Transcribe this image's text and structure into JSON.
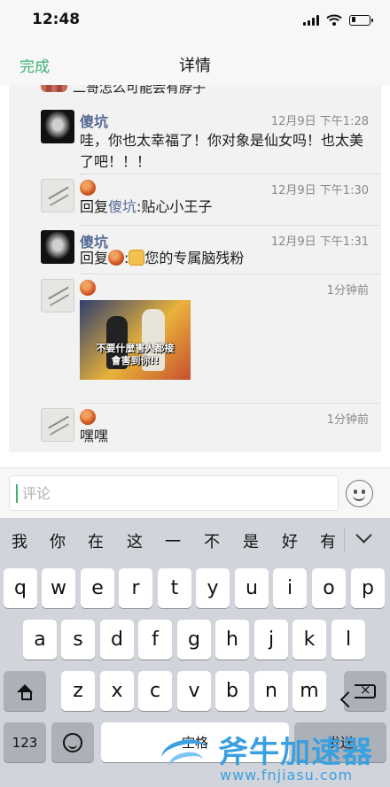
{
  "status_bar": {
    "time": "12:48",
    "battery_level": 0.25,
    "icons": [
      "signal-icon",
      "wifi-icon",
      "battery-icon"
    ]
  },
  "nav": {
    "done_label": "完成",
    "title": "详情",
    "accent_color": "#3cb371"
  },
  "comments": {
    "top_partial_text": "二哥怎么可能会有脖子",
    "items": [
      {
        "author": "傻坑",
        "time": "12月9日 下午1:28",
        "text": "哇，你也太幸福了！你对象是仙女吗！也太美了吧！！！"
      },
      {
        "author_icon": "orange-ball-emoji-icon",
        "time": "12月9日 下午1:30",
        "reply_prefix": "回复",
        "reply_to": "傻坑",
        "reply_sep": ":",
        "text": "贴心小王子"
      },
      {
        "author": "傻坑",
        "time": "12月9日 下午1:31",
        "reply_prefix": "回复",
        "reply_sep": ":",
        "text": "您的专属脑残粉"
      },
      {
        "author_icon": "orange-ball-emoji-icon",
        "time": "1分钟前",
        "image_caption_line1": "不要什麼害人都接",
        "image_caption_line2": "會害到你!!"
      },
      {
        "author_icon": "orange-ball-emoji-icon",
        "time": "1分钟前",
        "text": "嘿嘿"
      }
    ],
    "name_color": "#576b95"
  },
  "comment_input": {
    "placeholder": "评论",
    "value": ""
  },
  "keyboard": {
    "candidates": [
      "我",
      "你",
      "在",
      "这",
      "一",
      "不",
      "是",
      "好",
      "有"
    ],
    "row1": [
      "q",
      "w",
      "e",
      "r",
      "t",
      "y",
      "u",
      "i",
      "o",
      "p"
    ],
    "row2": [
      "a",
      "s",
      "d",
      "f",
      "g",
      "h",
      "j",
      "k",
      "l"
    ],
    "row3": [
      "z",
      "x",
      "c",
      "v",
      "b",
      "n",
      "m"
    ],
    "numbers_label": "123",
    "space_label": "空格",
    "return_label": "发送"
  },
  "watermark": {
    "title": "斧牛加速器",
    "url": "www.fnjiasu.com"
  }
}
